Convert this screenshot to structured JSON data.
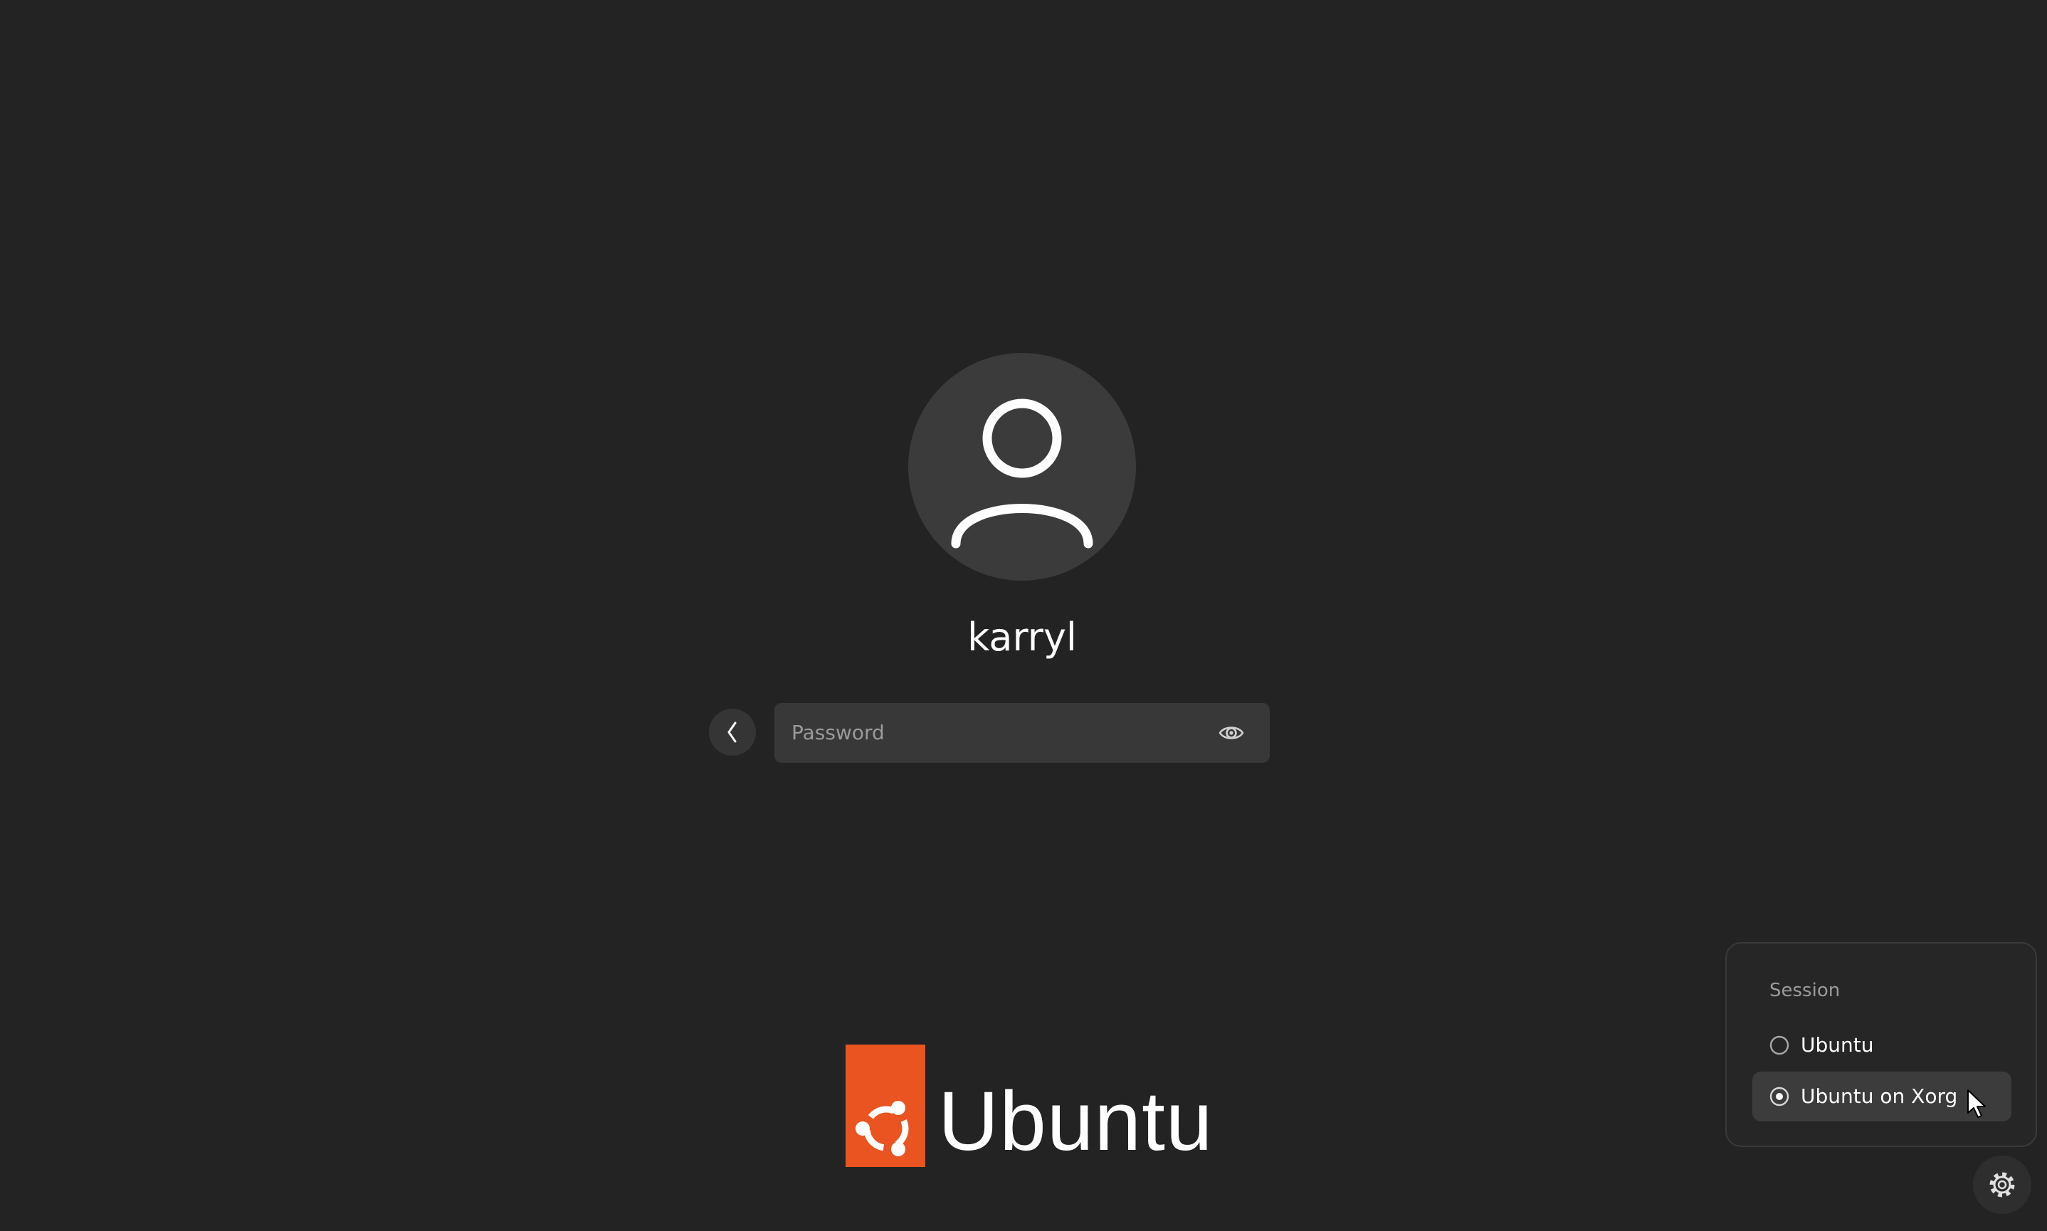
{
  "screen": "login",
  "user": {
    "name": "karryl",
    "avatar_icon": "user-avatar-icon"
  },
  "login": {
    "back_icon": "chevron-left-icon",
    "password_placeholder": "Password",
    "reveal_icon": "eye-icon"
  },
  "branding": {
    "logo_text": "Ubuntu",
    "logo_color": "#E95420"
  },
  "session_menu": {
    "heading": "Session",
    "options": [
      {
        "label": "Ubuntu",
        "selected": false
      },
      {
        "label": "Ubuntu on Xorg",
        "selected": true
      }
    ]
  },
  "settings_icon": "gear-icon",
  "colors": {
    "background": "#232323",
    "panel": "#262626",
    "highlight": "#3c3c3c",
    "text": "#ffffff",
    "muted_text": "#9a9a9a"
  }
}
